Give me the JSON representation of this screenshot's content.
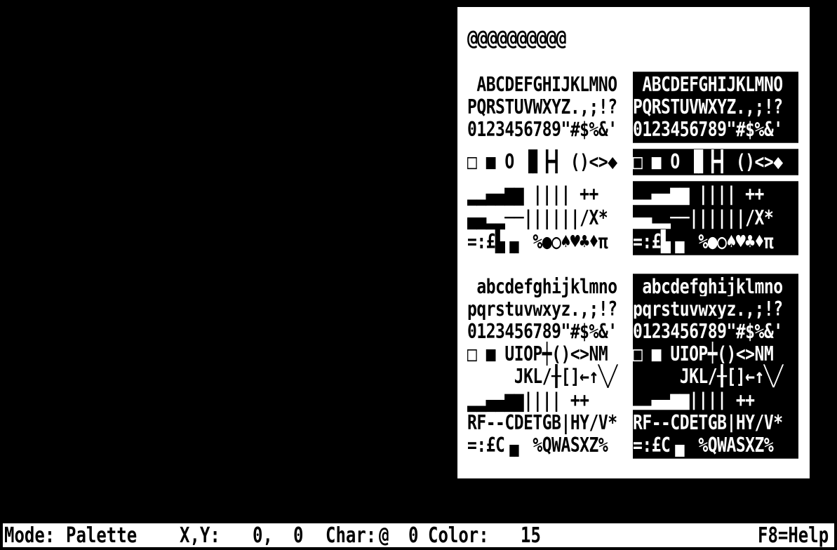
{
  "palette": {
    "top_row": "@@@@@@@@@@",
    "upper_block": [
      " ABCDEFGHIJKLMNO",
      "PQRSTUVWXYZ.,;!?",
      "0123456789\"#$%&'",
      "□ ■ O ▐▌┣┫ ()<>◆",
      "▂▂▄▄▆▆ |||| ++",
      "▄▄▂▂──||||||/X*",
      "=:£▙▗▖ %●○♠♥♣♦π"
    ],
    "lower_block": [
      " abcdefghijklmno",
      "pqrstuvwxyz.,;!?",
      "0123456789\"#$%&'",
      "□ ■ UIOP┿()<>NM",
      "     JKL/╂[]←↑╲╱",
      "▂▂▄▄▆▆|||| ++",
      "RF--CDETGB|HY/V*",
      "=:£C▗▖ %QWASXZ%"
    ]
  },
  "statusbar": {
    "mode_label": "Mode:",
    "mode_value": "Palette",
    "xy_label": "X,Y:",
    "x_value": "0,",
    "y_value": "0",
    "char_label": "Char:",
    "char_value": "@",
    "char_code": "0",
    "color_label": "Color:",
    "color_value": "15",
    "help_label": "F8=Help"
  }
}
